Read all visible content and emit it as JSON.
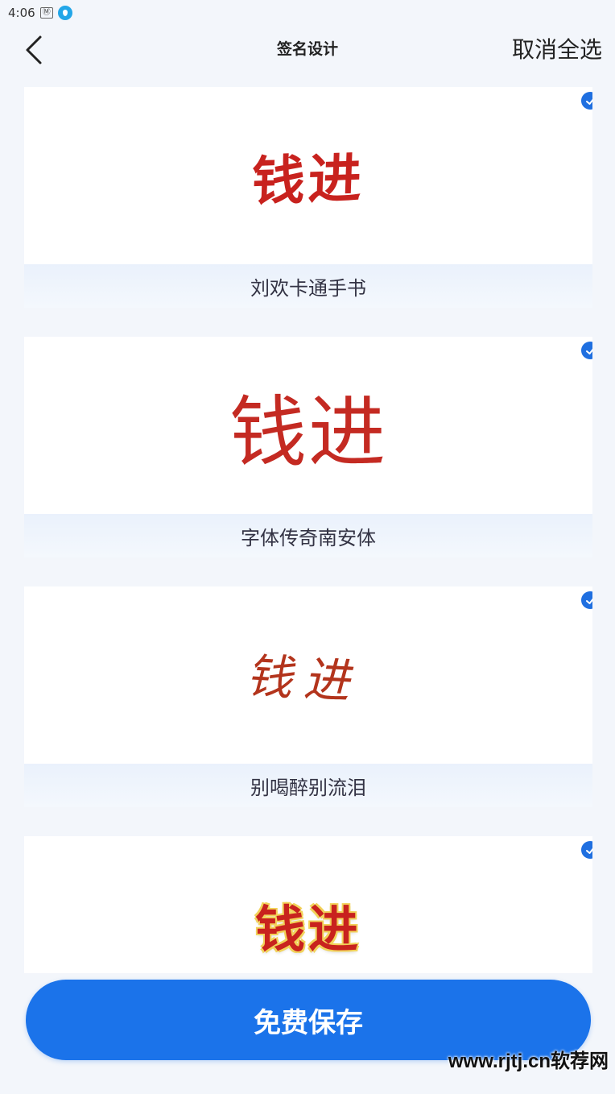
{
  "status_bar": {
    "time": "4:06",
    "sim_label": "Ⓜ"
  },
  "nav": {
    "title": "签名设计",
    "deselect_all": "取消全选"
  },
  "signature_name": "钱进",
  "fonts": [
    {
      "label": "刘欢卡通手书",
      "selected": true
    },
    {
      "label": "字体传奇南安体",
      "selected": true
    },
    {
      "label": "别喝醉别流泪",
      "selected": true
    },
    {
      "label": "",
      "selected": true
    }
  ],
  "save_button": {
    "label": "免费保存"
  },
  "watermark": "www.rjtj.cn软荐网",
  "colors": {
    "accent": "#1b73ea",
    "signature": "#c8221e",
    "check": "#1f6fe0"
  }
}
